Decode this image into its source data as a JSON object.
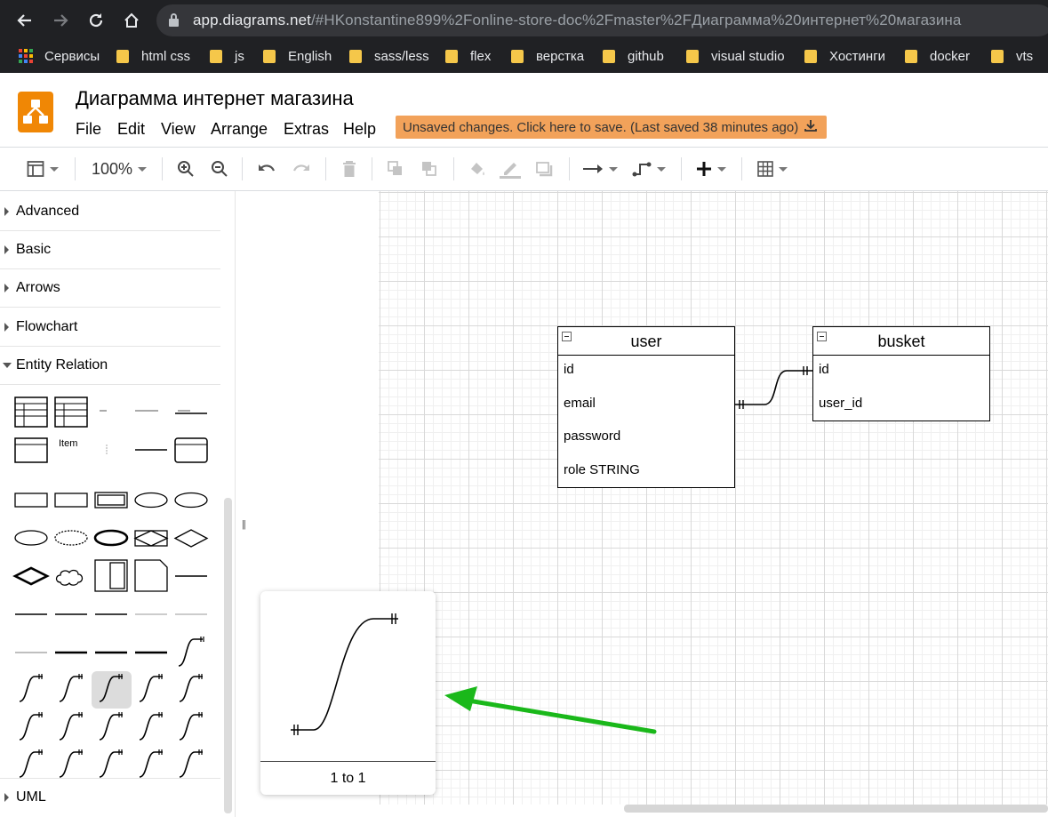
{
  "browser": {
    "url_host": "app.diagrams.net",
    "url_path": "/#HKonstantine899%2Fonline-store-doc%2Fmaster%2FДиаграмма%20интернет%20магазина",
    "bookmarks": [
      "Сервисы",
      "html css",
      "js",
      "English",
      "sass/less",
      "flex",
      "верстка",
      "github",
      "visual studio",
      "Хостинги",
      "docker",
      "vts"
    ]
  },
  "app": {
    "title": "Диаграмма интернет магазина",
    "menu": [
      "File",
      "Edit",
      "View",
      "Arrange",
      "Extras",
      "Help"
    ],
    "save_banner": "Unsaved changes. Click here to save. (Last saved 38 minutes ago)",
    "brand_color": "#f08705",
    "banner_color": "#f2a25a"
  },
  "toolbar": {
    "zoom": "100%"
  },
  "sidebar": {
    "sections": [
      "Advanced",
      "Basic",
      "Arrows",
      "Flowchart",
      "Entity Relation"
    ],
    "bottom_section": "UML",
    "item_label": "Item"
  },
  "diagram": {
    "user_table": {
      "title": "user",
      "rows": [
        "id",
        "email",
        "password",
        "role STRING"
      ]
    },
    "busket_table": {
      "title": "busket",
      "rows": [
        "id",
        "user_id"
      ]
    }
  },
  "preview": {
    "label": "1 to 1"
  },
  "annotation": {
    "arrow_color": "#1ab81a"
  }
}
